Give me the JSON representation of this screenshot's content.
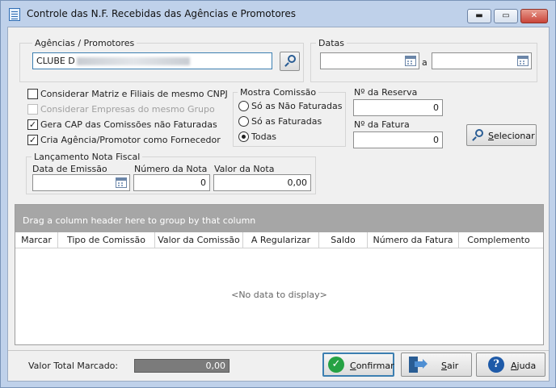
{
  "window": {
    "title": "Controle das N.F. Recebidas das Agências e Promotores",
    "controls": {
      "minimize": "▬",
      "maximize": "▭",
      "close": "✕"
    }
  },
  "agencias": {
    "group_label": "Agências  / Promotores",
    "value": "CLUBE D"
  },
  "datas": {
    "group_label": "Datas",
    "separator": "a",
    "start": "",
    "end": ""
  },
  "options": {
    "matriz_filiais": {
      "label": "Considerar Matriz e Filiais de mesmo CNPJ",
      "checked": false,
      "enabled": true
    },
    "empresas_grupo": {
      "label": "Considerar Empresas do mesmo Grupo",
      "checked": false,
      "enabled": false
    },
    "gera_cap": {
      "label": "Gera CAP das Comissões não Faturadas",
      "checked": true,
      "enabled": true
    },
    "cria_agencia": {
      "label": "Cria Agência/Promotor como Fornecedor",
      "checked": true,
      "enabled": true
    }
  },
  "mostra_comissao": {
    "group_label": "Mostra Comissão",
    "options": [
      {
        "label": "Só as Não Faturadas",
        "selected": false
      },
      {
        "label": "Só as Faturadas",
        "selected": false
      },
      {
        "label": "Todas",
        "selected": true
      }
    ]
  },
  "reserva": {
    "label": "Nº da Reserva",
    "value": "0"
  },
  "fatura": {
    "label": "Nº da Fatura",
    "value": "0"
  },
  "selecionar_button": {
    "mnemonic": "S",
    "rest": "elecionar"
  },
  "lancamento": {
    "group_label": "Lançamento Nota Fiscal",
    "data_emissao": {
      "label": "Data de Emissão",
      "value": ""
    },
    "numero_nota": {
      "label": "Número da Nota",
      "value": "0"
    },
    "valor_nota": {
      "label": "Valor da Nota",
      "value": "0,00"
    }
  },
  "grid": {
    "group_panel_text": "Drag a column header here to group by that column",
    "columns": [
      "Marcar",
      "Tipo de Comissão",
      "Valor da Comissão",
      "A Regularizar",
      "Saldo",
      "Número da Fatura",
      "Complemento"
    ],
    "empty_text": "<No data to display>"
  },
  "footer": {
    "total_label": "Valor Total Marcado:",
    "total_value": "0,00",
    "confirmar": {
      "mnemonic": "C",
      "rest": "onfirmar"
    },
    "sair": {
      "mnemonic": "S",
      "rest": "air"
    },
    "ajuda": {
      "mnemonic": "A",
      "rest": "juda"
    }
  },
  "colors": {
    "window_frame": "#bfd1ea",
    "client_bg": "#f0f0f0",
    "group_panel": "#a6a6a6",
    "total_field": "#7b7b7b",
    "close_button": "#c9453a"
  }
}
